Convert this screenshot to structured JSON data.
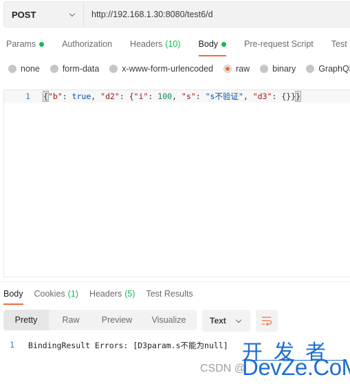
{
  "request": {
    "method": "POST",
    "url": "http://192.168.1.30:8080/test6/d"
  },
  "request_tabs": [
    {
      "label": "Params",
      "dot": true,
      "count": ""
    },
    {
      "label": "Authorization",
      "dot": false,
      "count": ""
    },
    {
      "label": "Headers",
      "dot": false,
      "count": "(10)"
    },
    {
      "label": "Body",
      "dot": true,
      "count": "",
      "active": true
    },
    {
      "label": "Pre-request Script",
      "dot": false,
      "count": ""
    },
    {
      "label": "Test",
      "dot": false,
      "count": ""
    }
  ],
  "body_types": [
    {
      "label": "none",
      "checked": false
    },
    {
      "label": "form-data",
      "checked": false
    },
    {
      "label": "x-www-form-urlencoded",
      "checked": false
    },
    {
      "label": "raw",
      "checked": true
    },
    {
      "label": "binary",
      "checked": false
    },
    {
      "label": "GraphQL",
      "checked": false
    }
  ],
  "editor": {
    "line_number": "1",
    "tokens": {
      "open": "{",
      "k_b": "\"b\"",
      "colon1": ": ",
      "v_true": "true",
      "comma1": ", ",
      "k_d2": "\"d2\"",
      "colon2": ": ",
      "open2": "{",
      "k_i": "\"i\"",
      "colon3": ": ",
      "v_100": "100",
      "comma2": ", ",
      "k_s": "\"s\"",
      "colon4": ": ",
      "v_s": "\"s不验证\"",
      "comma3": ", ",
      "k_d3": "\"d3\"",
      "colon5": ": ",
      "v_d3": "{}",
      "close2": "}",
      "close": "}"
    }
  },
  "response_tabs": [
    {
      "label": "Body",
      "count": "",
      "active": true
    },
    {
      "label": "Cookies",
      "count": "(1)"
    },
    {
      "label": "Headers",
      "count": "(5)"
    },
    {
      "label": "Test Results",
      "count": ""
    }
  ],
  "view_modes": [
    "Pretty",
    "Raw",
    "Preview",
    "Visualize"
  ],
  "format": "Text",
  "response": {
    "line_number": "1",
    "text": "BindingResult Errors: [D3param.s不能为null]"
  },
  "watermark": {
    "csdn": "CSDN @",
    "cn": "开发者",
    "en": "DevZe.CoM"
  },
  "colors": {
    "accent": "#f26b3a",
    "status_green": "#0cbb52",
    "watermark_blue": "#1d6fce"
  }
}
